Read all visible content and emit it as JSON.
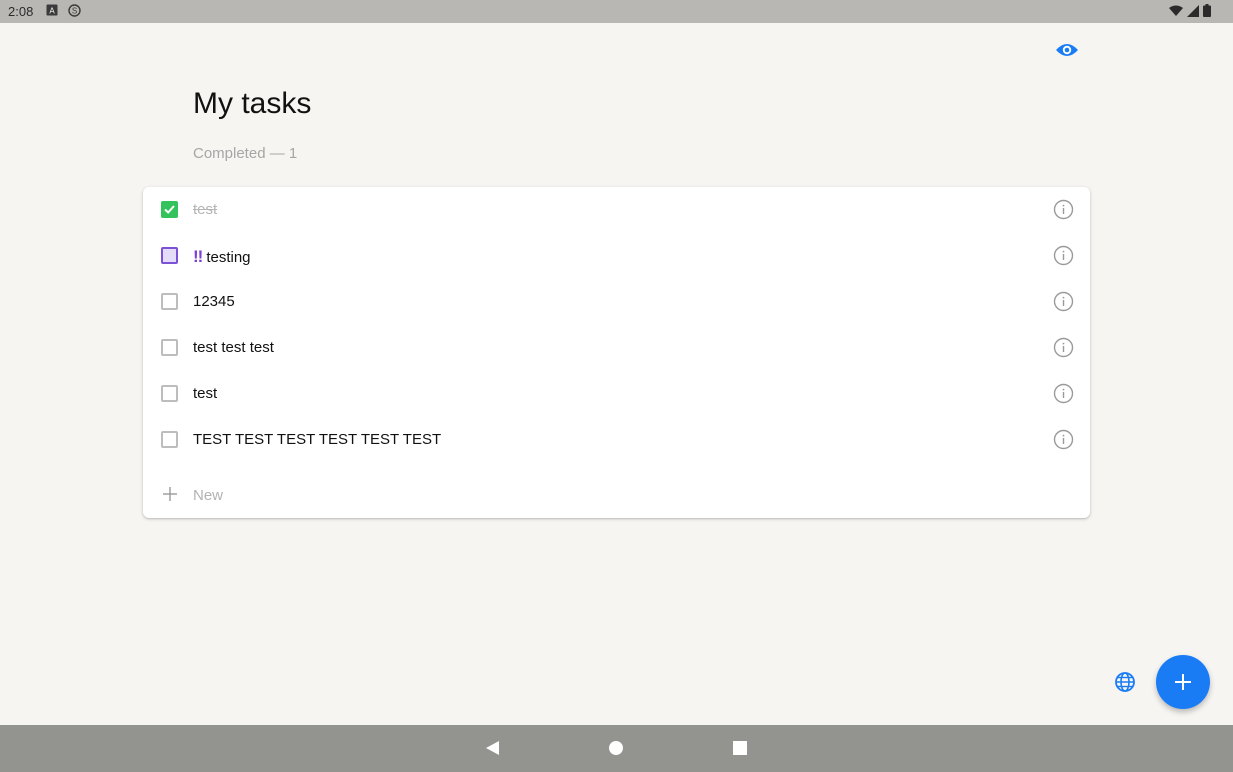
{
  "status_bar": {
    "time": "2:08",
    "left_icons": [
      "a-square-icon",
      "s-circle-icon"
    ],
    "right_icons": [
      "wifi-icon",
      "cell-signal-icon",
      "battery-icon"
    ]
  },
  "header": {
    "title": "My tasks",
    "completed_text": "Completed — 1",
    "visibility_icon": "eye-icon"
  },
  "tasks": [
    {
      "label": "test",
      "completed": true,
      "priority": ""
    },
    {
      "label": "testing",
      "completed": false,
      "priority": "!!"
    },
    {
      "label": "12345",
      "completed": false,
      "priority": ""
    },
    {
      "label": "test test test",
      "completed": false,
      "priority": ""
    },
    {
      "label": "test",
      "completed": false,
      "priority": ""
    },
    {
      "label": "TEST TEST TEST TEST TEST TEST",
      "completed": false,
      "priority": ""
    }
  ],
  "new_task": {
    "placeholder": "New",
    "icon": "plus-icon"
  },
  "fab": {
    "icon": "plus-icon"
  },
  "globe": {
    "icon": "globe-icon"
  },
  "nav": [
    "back-icon",
    "home-icon",
    "recents-icon"
  ],
  "colors": {
    "accent": "#1a7cf5",
    "check_green": "#33c25c",
    "priority_purple": "#7b3fd1",
    "background": "#f6f5f2"
  }
}
